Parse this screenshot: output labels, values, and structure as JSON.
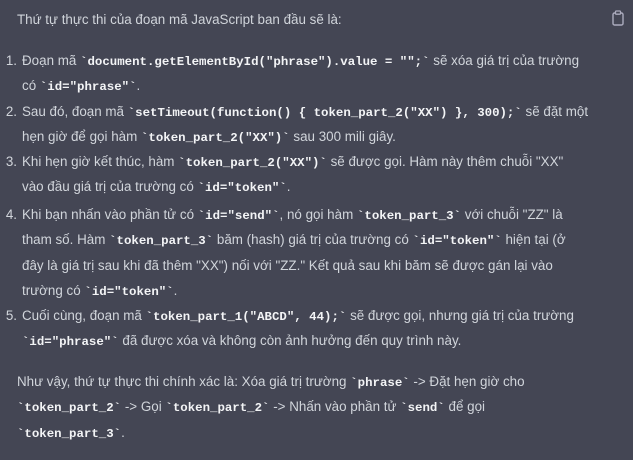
{
  "message": {
    "intro": "Thứ tự thực thi của đoạn mã JavaScript ban đầu sẽ là:",
    "copy_icon": "clipboard-icon",
    "steps": [
      {
        "number": "1.",
        "l1a": "Đoạn mã ",
        "l1code": "`document.getElementById(\"phrase\").value = \"\";`",
        "l1b": " sẽ xóa giá trị của trường",
        "l2a": "có ",
        "l2code": "`id=\"phrase\"`",
        "l2b": "."
      },
      {
        "number": "2.",
        "l1a": "Sau đó, đoạn mã ",
        "l1code": "`setTimeout(function() { token_part_2(\"XX\") }, 300);`",
        "l1b": " sẽ đặt một",
        "l2a": "hẹn giờ để gọi hàm ",
        "l2code": "`token_part_2(\"XX\")`",
        "l2b": " sau 300 mili giây."
      },
      {
        "number": "3.",
        "l1a": "Khi hẹn giờ kết thúc, hàm ",
        "l1code": "`token_part_2(\"XX\")`",
        "l1b": " sẽ được gọi. Hàm này thêm chuỗi \"XX\"",
        "l2a": "vào đầu giá trị của trường có ",
        "l2code": "`id=\"token\"`",
        "l2b": "."
      },
      {
        "number": "4.",
        "l1a": "Khi bạn nhấn vào phần tử có ",
        "l1code": "`id=\"send\"`",
        "l1b": ", nó gọi hàm ",
        "l1code2": "`token_part_3`",
        "l1c": " với chuỗi \"ZZ\" là",
        "l2a": "tham số. Hàm ",
        "l2code": "`token_part_3`",
        "l2b": " băm (hash) giá trị của trường có ",
        "l2code2": "`id=\"token\"`",
        "l2c": " hiện tại (ở",
        "l3a": "đây là giá trị sau khi đã thêm \"XX\") nối với \"ZZ.\" Kết quả sau khi băm sẽ được gán lại vào",
        "l4a": "trường có ",
        "l4code": "`id=\"token\"`",
        "l4b": "."
      },
      {
        "number": "5.",
        "l1a": "Cuối cùng, đoạn mã ",
        "l1code": "`token_part_1(\"ABCD\", 44);`",
        "l1b": " sẽ được gọi, nhưng giá trị của trường",
        "l2code": "`id=\"phrase\"`",
        "l2b": " đã được xóa và không còn ảnh hưởng đến quy trình này."
      }
    ],
    "outro": {
      "l1a": "Như vậy, thứ tự thực thi chính xác là: Xóa giá trị trường ",
      "l1code": "`phrase`",
      "l1b": " -> Đặt hẹn giờ cho",
      "l2code": "`token_part_2`",
      "l2b": " -> Gọi ",
      "l2code2": "`token_part_2`",
      "l2c": " -> Nhấn vào phần tử ",
      "l2code3": "`send`",
      "l2d": " để gọi",
      "l3code": "`token_part_3`",
      "l3b": "."
    }
  }
}
